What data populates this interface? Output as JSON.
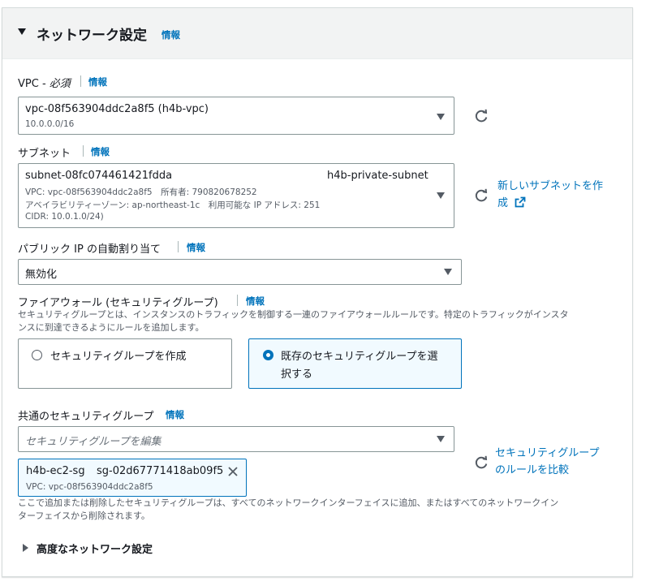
{
  "section": {
    "title": "ネットワーク設定",
    "info": "情報"
  },
  "vpc": {
    "label": "VPC - ",
    "required": "必須",
    "info": "情報",
    "value": "vpc-08f563904ddc2a8f5 (h4b-vpc)",
    "cidr": "10.0.0.0/16"
  },
  "subnet": {
    "label": "サブネット",
    "info": "情報",
    "id": "subnet-08fc074461421fdda",
    "name": "h4b-private-subnet",
    "vpc_line": "VPC: vpc-08f563904ddc2a8f5　所有者: 790820678252",
    "az_line": "アベイラビリティーゾーン: ap-northeast-1c　利用可能な IP アドレス: 251",
    "cidr_line": "CIDR: 10.0.1.0/24)",
    "create_link_line1": "新しいサブネットを作",
    "create_link_line2": "成"
  },
  "public_ip": {
    "label": "パブリック IP の自動割り当て",
    "info": "情報",
    "value": "無効化"
  },
  "firewall": {
    "label": "ファイアウォール (セキュリティグループ)",
    "info": "情報",
    "desc_line1": "セキュリティグループとは、インスタンスのトラフィックを制御する一連のファイアウォールルールです。特定のトラフィックがインスタ",
    "desc_line2": "ンスに到達できるようにルールを追加します。",
    "option_create": "セキュリティグループを作成",
    "option_existing_line1": "既存のセキュリティグループを選",
    "option_existing_line2": "択する",
    "selected": "existing"
  },
  "common_sg": {
    "label": "共通のセキュリティグループ",
    "info": "情報",
    "placeholder": "セキュリティグループを編集",
    "compare_link_line1": "セキュリティグループ",
    "compare_link_line2": "のルールを比較",
    "token_name": "h4b-ec2-sg",
    "token_id": "sg-02d67771418ab09f5",
    "token_vpc": "VPC: vpc-08f563904ddc2a8f5",
    "note_line1": "ここで追加または削除したセキュリティグループは、すべてのネットワークインターフェイスに追加、またはすべてのネットワークイン",
    "note_line2": "ターフェイスから削除されます。"
  },
  "advanced": {
    "label": "高度なネットワーク設定"
  },
  "colors": {
    "link": "#0073bb",
    "border": "#879596",
    "header_bg": "#f2f3f3"
  }
}
